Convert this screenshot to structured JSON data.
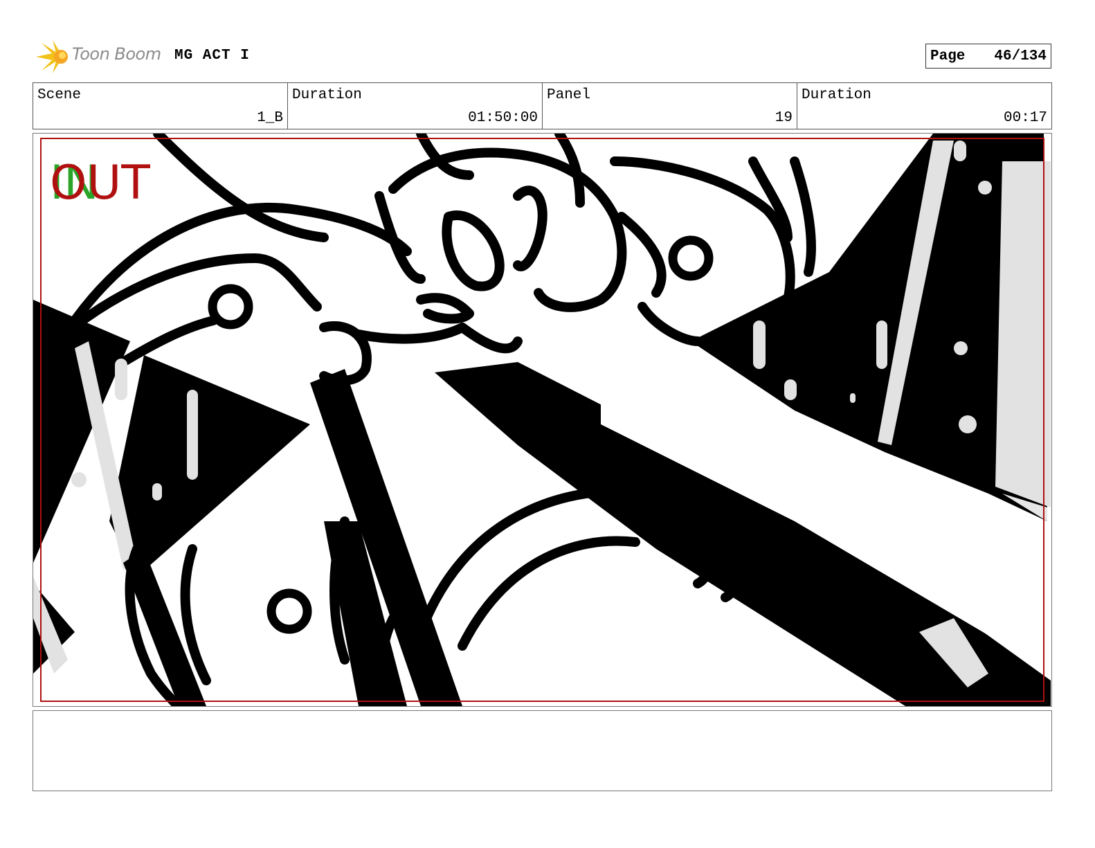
{
  "header": {
    "logo_text": "Toon Boom",
    "project_title": "MG ACT I",
    "page_label": "Page",
    "page_value": "46/134"
  },
  "fields": [
    {
      "label": "Scene",
      "value": "1_B"
    },
    {
      "label": "Duration",
      "value": "01:50:00"
    },
    {
      "label": "Panel",
      "value": "19"
    },
    {
      "label": "Duration",
      "value": "00:17"
    }
  ],
  "panel": {
    "in_marker": "IN",
    "out_marker": "OUT",
    "in_color": "#2aa52a",
    "out_color": "#b01010",
    "safe_frame_color": "#b01010"
  },
  "notes": {
    "text": ""
  }
}
